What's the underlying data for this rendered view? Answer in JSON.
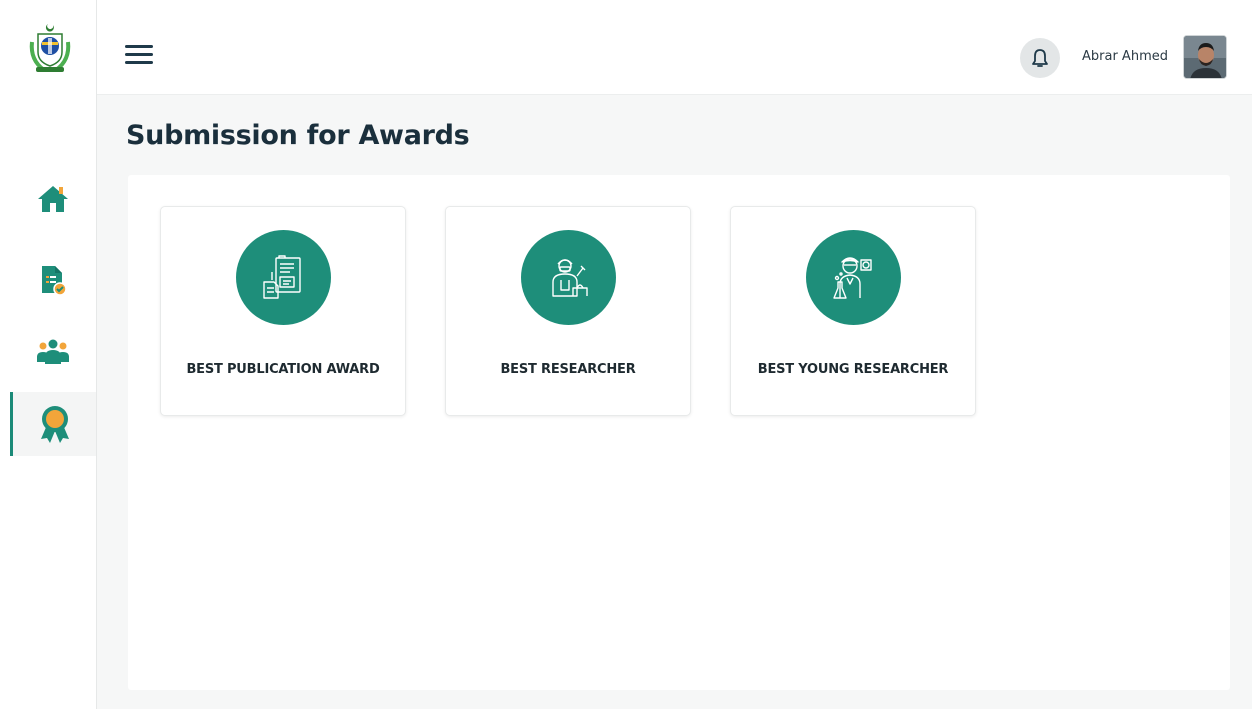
{
  "header": {
    "user_name": "Abrar Ahmed"
  },
  "sidebar": {
    "items": [
      {
        "name": "home",
        "icon": "home-icon"
      },
      {
        "name": "documents",
        "icon": "document-check-icon"
      },
      {
        "name": "team",
        "icon": "users-icon"
      },
      {
        "name": "awards",
        "icon": "award-ribbon-icon",
        "active": true
      }
    ]
  },
  "main": {
    "title": "Submission for Awards",
    "awards": [
      {
        "label": "BEST PUBLICATION AWARD",
        "icon": "publication-icon"
      },
      {
        "label": "BEST RESEARCHER",
        "icon": "researcher-icon"
      },
      {
        "label": "BEST YOUNG RESEARCHER",
        "icon": "young-researcher-icon"
      }
    ]
  },
  "colors": {
    "accent": "#1e8e7a",
    "title": "#1a2f3c",
    "award_orange": "#f2a53a"
  }
}
